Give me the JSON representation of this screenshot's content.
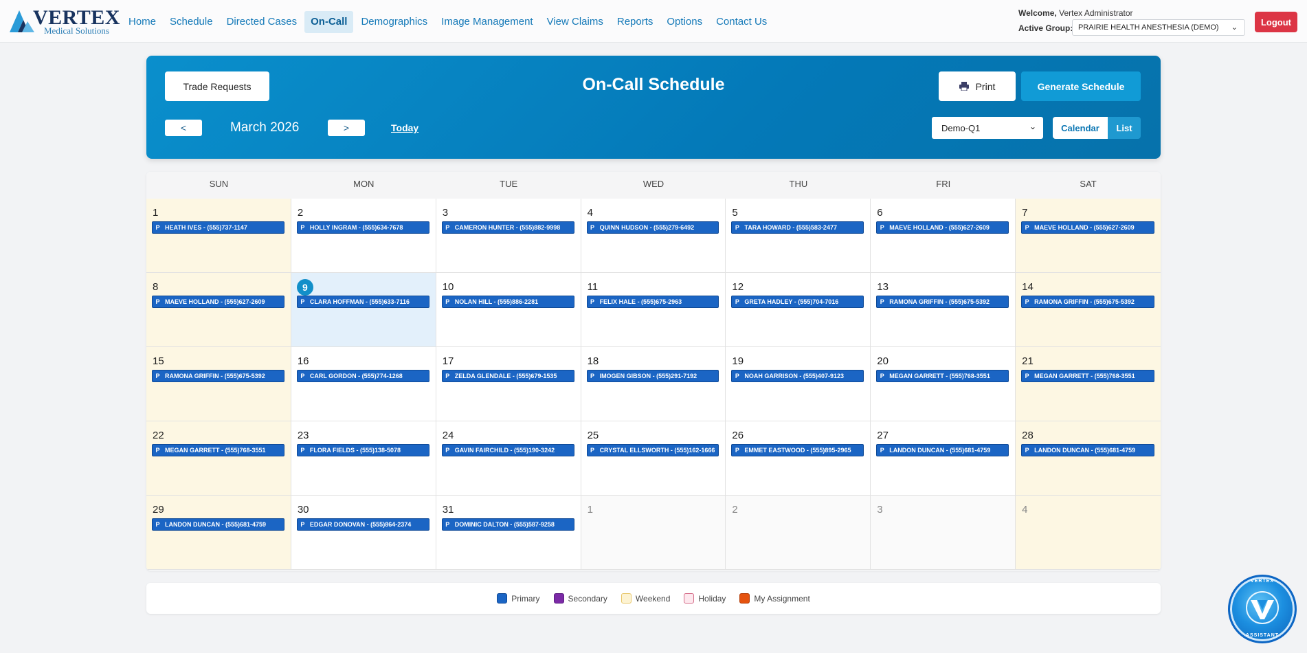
{
  "app": {
    "logo_word": "VERTEX",
    "logo_sub": "Medical Solutions"
  },
  "nav": [
    {
      "label": "Home",
      "active": false
    },
    {
      "label": "Schedule",
      "active": false
    },
    {
      "label": "Directed Cases",
      "active": false
    },
    {
      "label": "On-Call",
      "active": true
    },
    {
      "label": "Demographics",
      "active": false
    },
    {
      "label": "Image Management",
      "active": false
    },
    {
      "label": "View Claims",
      "active": false
    },
    {
      "label": "Reports",
      "active": false
    },
    {
      "label": "Options",
      "active": false
    },
    {
      "label": "Contact Us",
      "active": false
    }
  ],
  "user": {
    "welcome_label": "Welcome,",
    "name": "Vertex Administrator",
    "active_group_label": "Active Group:",
    "active_group": "PRAIRIE HEALTH ANESTHESIA (DEMO)",
    "logout_label": "Logout"
  },
  "header": {
    "title": "On-Call Schedule",
    "trade_requests_label": "Trade Requests",
    "print_label": "Print",
    "generate_label": "Generate Schedule",
    "prev_label": "<",
    "next_label": ">",
    "month_label": "March 2026",
    "today_label": "Today",
    "schedule_select": "Demo-Q1",
    "view_calendar_label": "Calendar",
    "view_list_label": "List",
    "active_view": "Calendar"
  },
  "calendar": {
    "weekdays": [
      "SUN",
      "MON",
      "TUE",
      "WED",
      "THU",
      "FRI",
      "SAT"
    ],
    "today": 9,
    "days": [
      {
        "day": "1",
        "current": true,
        "event": "HEATH IVES - (555)737-1147"
      },
      {
        "day": "2",
        "current": true,
        "event": "HOLLY INGRAM - (555)634-7678"
      },
      {
        "day": "3",
        "current": true,
        "event": "CAMERON HUNTER - (555)882-9998"
      },
      {
        "day": "4",
        "current": true,
        "event": "QUINN HUDSON - (555)279-6492"
      },
      {
        "day": "5",
        "current": true,
        "event": "TARA HOWARD - (555)583-2477"
      },
      {
        "day": "6",
        "current": true,
        "event": "MAEVE HOLLAND - (555)627-2609"
      },
      {
        "day": "7",
        "current": true,
        "event": "MAEVE HOLLAND - (555)627-2609"
      },
      {
        "day": "8",
        "current": true,
        "event": "MAEVE HOLLAND - (555)627-2609"
      },
      {
        "day": "9",
        "current": true,
        "event": "CLARA HOFFMAN - (555)633-7116"
      },
      {
        "day": "10",
        "current": true,
        "event": "NOLAN HILL - (555)886-2281"
      },
      {
        "day": "11",
        "current": true,
        "event": "FELIX HALE - (555)675-2963"
      },
      {
        "day": "12",
        "current": true,
        "event": "GRETA HADLEY - (555)704-7016"
      },
      {
        "day": "13",
        "current": true,
        "event": "RAMONA GRIFFIN - (555)675-5392"
      },
      {
        "day": "14",
        "current": true,
        "event": "RAMONA GRIFFIN - (555)675-5392"
      },
      {
        "day": "15",
        "current": true,
        "event": "RAMONA GRIFFIN - (555)675-5392"
      },
      {
        "day": "16",
        "current": true,
        "event": "CARL GORDON - (555)774-1268"
      },
      {
        "day": "17",
        "current": true,
        "event": "ZELDA GLENDALE - (555)679-1535"
      },
      {
        "day": "18",
        "current": true,
        "event": "IMOGEN GIBSON - (555)291-7192"
      },
      {
        "day": "19",
        "current": true,
        "event": "NOAH GARRISON - (555)407-9123"
      },
      {
        "day": "20",
        "current": true,
        "event": "MEGAN GARRETT - (555)768-3551"
      },
      {
        "day": "21",
        "current": true,
        "event": "MEGAN GARRETT - (555)768-3551"
      },
      {
        "day": "22",
        "current": true,
        "event": "MEGAN GARRETT - (555)768-3551"
      },
      {
        "day": "23",
        "current": true,
        "event": "FLORA FIELDS - (555)138-5078"
      },
      {
        "day": "24",
        "current": true,
        "event": "GAVIN FAIRCHILD - (555)190-3242"
      },
      {
        "day": "25",
        "current": true,
        "event": "CRYSTAL ELLSWORTH - (555)162-1666"
      },
      {
        "day": "26",
        "current": true,
        "event": "EMMET EASTWOOD - (555)895-2965"
      },
      {
        "day": "27",
        "current": true,
        "event": "LANDON DUNCAN - (555)681-4759"
      },
      {
        "day": "28",
        "current": true,
        "event": "LANDON DUNCAN - (555)681-4759"
      },
      {
        "day": "29",
        "current": true,
        "event": "LANDON DUNCAN - (555)681-4759"
      },
      {
        "day": "30",
        "current": true,
        "event": "EDGAR DONOVAN - (555)864-2374"
      },
      {
        "day": "31",
        "current": true,
        "event": "DOMINIC DALTON - (555)587-9258"
      },
      {
        "day": "1",
        "current": false,
        "event": ""
      },
      {
        "day": "2",
        "current": false,
        "event": ""
      },
      {
        "day": "3",
        "current": false,
        "event": ""
      },
      {
        "day": "4",
        "current": false,
        "event": ""
      }
    ],
    "event_tag": "P"
  },
  "legend": [
    {
      "label": "Primary",
      "color": "#1b65c4",
      "border": "#0f4a97"
    },
    {
      "label": "Secondary",
      "color": "#7b2aa6",
      "border": "#5c1c80"
    },
    {
      "label": "Weekend",
      "color": "#fdf3d2",
      "border": "#e8c66a"
    },
    {
      "label": "Holiday",
      "color": "#fde8ee",
      "border": "#d46a86"
    },
    {
      "label": "My Assignment",
      "color": "#e5530f",
      "border": "#b43c06"
    }
  ],
  "assistant": {
    "top_label": "VERTEX",
    "bottom_label": "ASSISTANT"
  }
}
